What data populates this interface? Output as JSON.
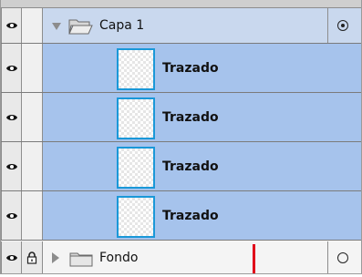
{
  "group": {
    "label": "Capa 1",
    "expanded": true,
    "visible": true,
    "targeted": true
  },
  "layers": [
    {
      "label": "Trazado",
      "visible": true
    },
    {
      "label": "Trazado",
      "visible": true
    },
    {
      "label": "Trazado",
      "visible": true
    },
    {
      "label": "Trazado",
      "visible": true
    }
  ],
  "bottom_group": {
    "label": "Fondo",
    "expanded": false,
    "visible": true,
    "locked": true,
    "targeted": false
  },
  "colors": {
    "selection": "#a6c3ec",
    "header": "#c9d8ee",
    "thumb_border": "#1a98d8",
    "insertion_marker": "#e0001a"
  },
  "icons": {
    "visibility": "eye-icon",
    "lock": "lock-icon",
    "expand": "disclosure-triangle-icon",
    "folder": "folder-icon",
    "target": "target-circle-icon"
  }
}
